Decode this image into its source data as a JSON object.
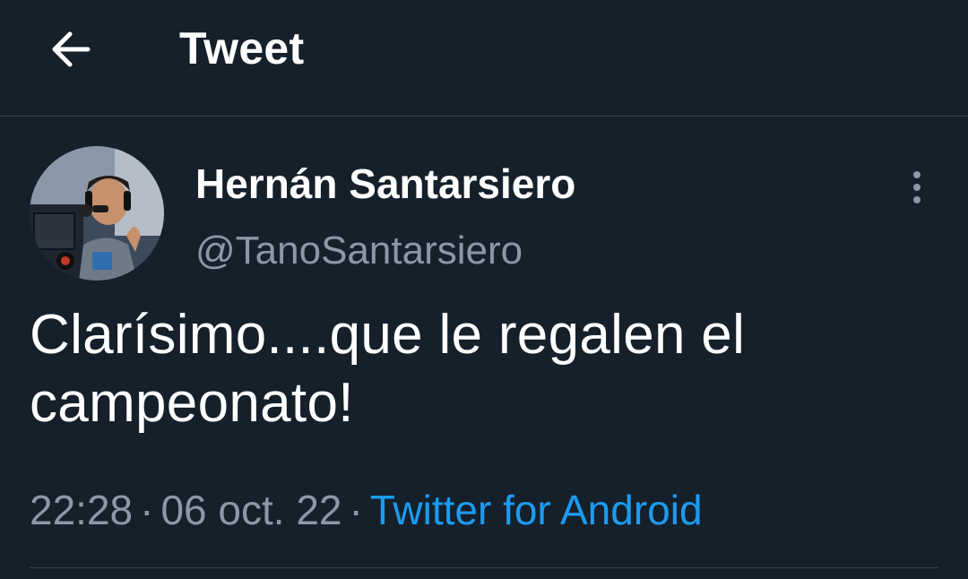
{
  "header": {
    "back_icon": "arrow-left-icon",
    "title": "Tweet"
  },
  "tweet": {
    "author": {
      "display_name": "Hernán Santarsiero",
      "handle": "@TanoSantarsiero",
      "avatar_icon": "profile-photo"
    },
    "more_icon": "more-vertical-icon",
    "text": "Clarísimo....que le regalen el campeonato!",
    "time": "22:28",
    "separator": "·",
    "date": "06 oct. 22",
    "source": "Twitter for Android"
  },
  "colors": {
    "background": "#15202b",
    "divider": "#38444d",
    "secondary_text": "#8b98a5",
    "link": "#1d9bf0"
  }
}
